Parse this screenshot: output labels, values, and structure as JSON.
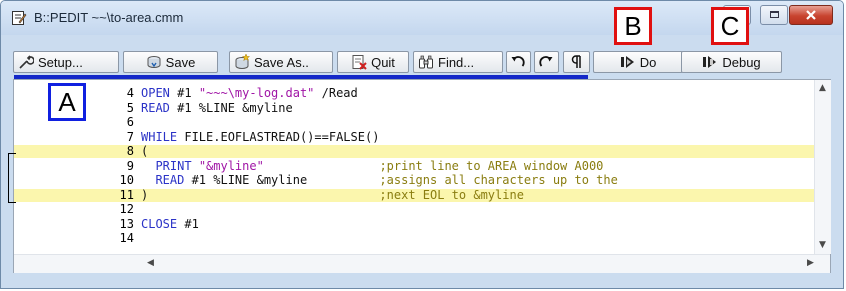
{
  "window": {
    "title": "B::PEDIT ~~\\to-area.cmm",
    "controls": [
      "minimize-icon",
      "maximize-icon",
      "close-icon"
    ],
    "close_color": "#c8442f"
  },
  "toolbar": {
    "buttons": [
      {
        "label": "Setup...",
        "icon": "wrench-icon"
      },
      {
        "label": "Save",
        "icon": "save-icon"
      },
      {
        "label": "Save As..",
        "icon": "save-as-icon"
      },
      {
        "label": "Quit",
        "icon": "quit-icon"
      },
      {
        "label": "Find...",
        "icon": "binoculars-icon"
      },
      {
        "label": "",
        "icon": "undo-icon"
      },
      {
        "label": "",
        "icon": "redo-icon"
      },
      {
        "label": "",
        "icon": "pilcrow-icon"
      },
      {
        "label": "Do",
        "icon": "do-icon"
      },
      {
        "label": "Debug",
        "icon": "debug-icon"
      }
    ]
  },
  "editor": {
    "lines": [
      {
        "num": "4",
        "tokens": [
          {
            "t": "OPEN",
            "c": "kw"
          },
          {
            "t": " #1 ",
            "c": "plain"
          },
          {
            "t": "\"~~~\\my-log.dat\"",
            "c": "str"
          },
          {
            "t": " /Read",
            "c": "plain"
          }
        ]
      },
      {
        "num": "5",
        "tokens": [
          {
            "t": "READ",
            "c": "kw"
          },
          {
            "t": " #1 %LINE &myline",
            "c": "plain"
          }
        ]
      },
      {
        "num": "6",
        "tokens": []
      },
      {
        "num": "7",
        "tokens": [
          {
            "t": "WHILE",
            "c": "kw"
          },
          {
            "t": " FILE.EOFLASTREAD()==FALSE()",
            "c": "plain"
          }
        ]
      },
      {
        "num": "8",
        "tokens": [
          {
            "t": "(",
            "c": "plain"
          }
        ],
        "highlight": true
      },
      {
        "num": "9",
        "tokens": [
          {
            "t": "  PRINT",
            "c": "kw"
          },
          {
            "t": " ",
            "c": "plain"
          },
          {
            "t": "\"&myline\"",
            "c": "str"
          },
          {
            "t": "                ;print line to AREA window A000",
            "c": "cmt"
          }
        ]
      },
      {
        "num": "10",
        "tokens": [
          {
            "t": "  READ",
            "c": "kw"
          },
          {
            "t": " #1 %LINE &myline        ",
            "c": "plain"
          },
          {
            "t": "  ;assigns all characters up to the",
            "c": "cmt"
          }
        ]
      },
      {
        "num": "11",
        "tokens": [
          {
            "t": ")",
            "c": "plain"
          },
          {
            "t": "                                ;next EOL to &myline",
            "c": "cmt"
          }
        ],
        "highlight": true
      },
      {
        "num": "12",
        "tokens": []
      },
      {
        "num": "13",
        "tokens": [
          {
            "t": "CLOSE",
            "c": "kw"
          },
          {
            "t": " #1",
            "c": "plain"
          }
        ]
      },
      {
        "num": "14",
        "tokens": []
      }
    ]
  },
  "annotations": {
    "a": "A",
    "b": "B",
    "c": "C",
    "red": "#e01010",
    "blue": "#1020e0"
  }
}
